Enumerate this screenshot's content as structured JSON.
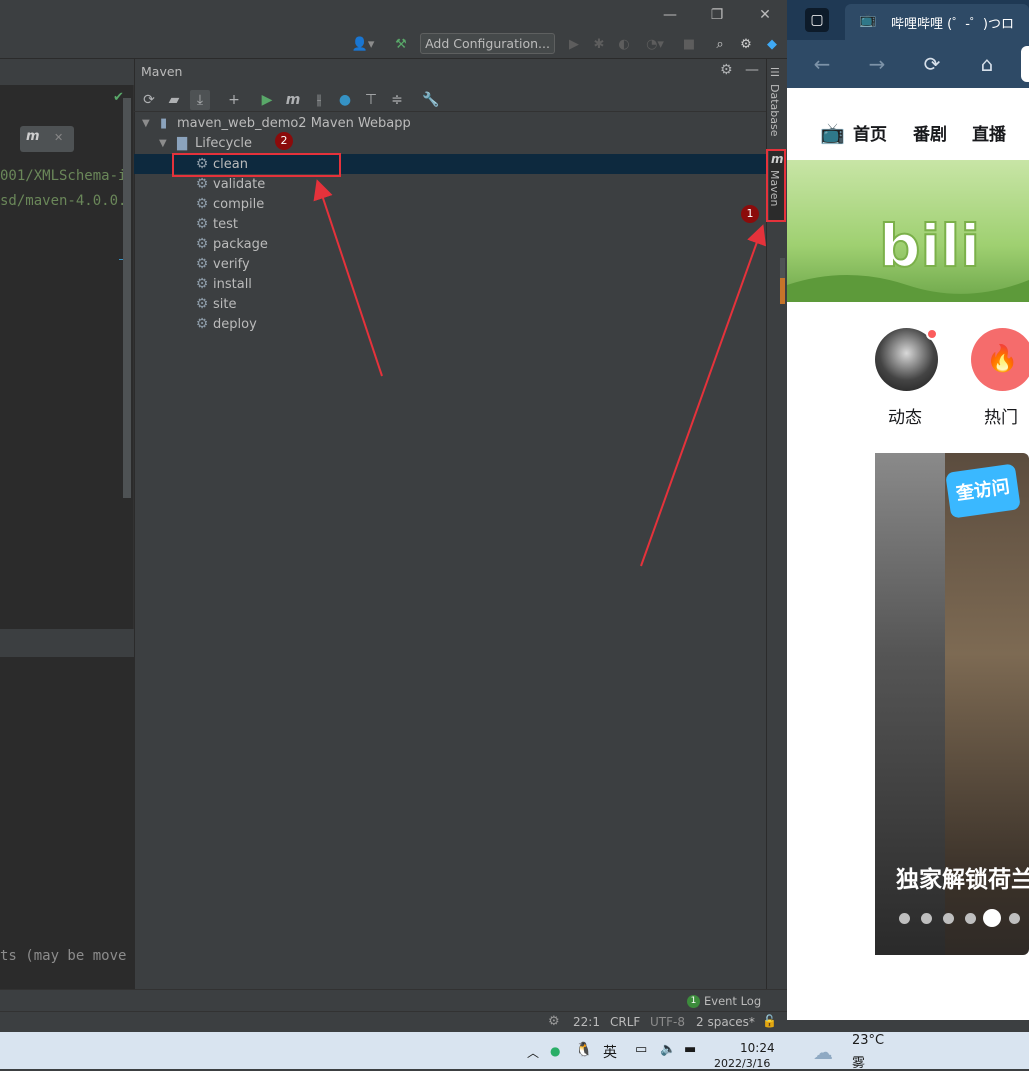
{
  "ide": {
    "window_controls": {
      "minimize": "—",
      "restore": "❐",
      "close": "✕"
    },
    "toolbar": {
      "add_configuration": "Add Configuration..."
    },
    "editor": {
      "code_lines": [
        "001/XMLSchema-i",
        "sd/maven-4.0.0."
      ],
      "bottom_text": "ts (may be move"
    },
    "maven": {
      "title": "Maven",
      "project": "maven_web_demo2 Maven Webapp",
      "lifecycle": "Lifecycle",
      "goals": [
        "clean",
        "validate",
        "compile",
        "test",
        "package",
        "verify",
        "install",
        "site",
        "deploy"
      ],
      "selected_goal": "clean"
    },
    "side_tabs": {
      "database": "Database",
      "maven": "Maven"
    },
    "status": {
      "event_log_count": "1",
      "event_log": "Event Log",
      "position": "22:1",
      "line_sep": "CRLF",
      "encoding": "UTF-8",
      "indent": "2 spaces*"
    }
  },
  "annotations": {
    "badge1": "1",
    "badge2": "2"
  },
  "browser": {
    "tab_title": "哔哩哔哩 (゜-゜)つロ",
    "nav": [
      "首页",
      "番剧",
      "直播"
    ],
    "channels": [
      {
        "label": "动态"
      },
      {
        "label": "热门"
      }
    ],
    "hero_title": "独家解锁荷兰",
    "hero_badge": "奎访问"
  },
  "taskbar": {
    "ime": "英",
    "time": "10:24",
    "date": "2022/3/16",
    "temperature": "23°C",
    "weather": "雾"
  },
  "colors": {
    "ide_bg": "#3c3f41",
    "selection": "#0d293e",
    "annotation_red": "#e5323b",
    "bilibili_pink": "#fb7299"
  }
}
